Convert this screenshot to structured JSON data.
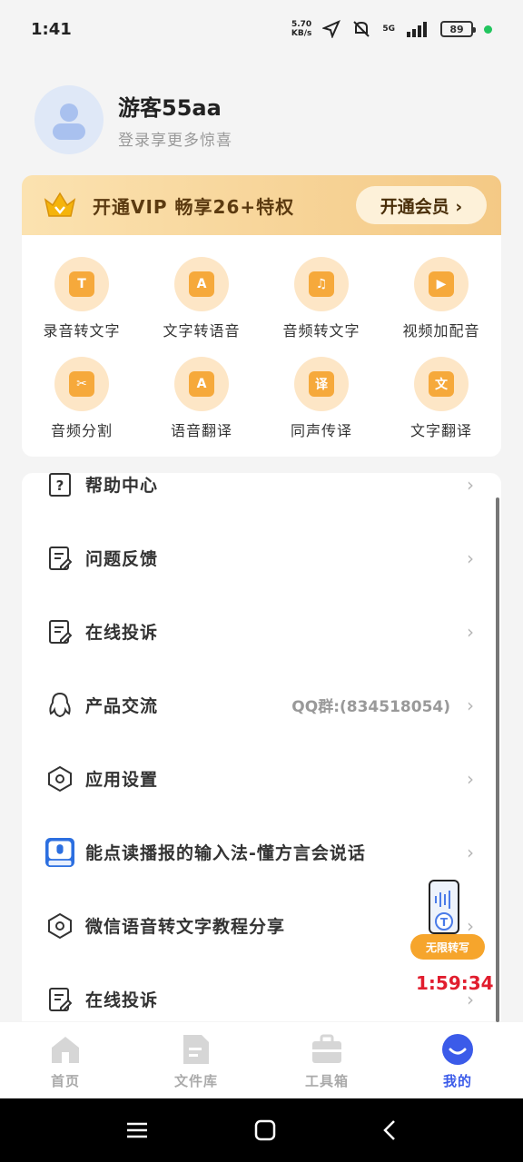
{
  "status": {
    "time": "1:41",
    "net_speed": "5.70",
    "net_unit": "KB/s",
    "signal": "5G",
    "battery": "89"
  },
  "profile": {
    "name": "游客55aa",
    "subtitle": "登录享更多惊喜"
  },
  "vip": {
    "text": "开通VIP 畅享26+特权",
    "button": "开通会员 ›"
  },
  "tools": [
    {
      "label": "录音转文字",
      "icon": "mic-text-icon"
    },
    {
      "label": "文字转语音",
      "icon": "text-speech-icon"
    },
    {
      "label": "音频转文字",
      "icon": "audio-text-icon"
    },
    {
      "label": "视频加配音",
      "icon": "video-dub-icon"
    },
    {
      "label": "音频分割",
      "icon": "scissors-icon"
    },
    {
      "label": "语音翻译",
      "icon": "voice-translate-icon"
    },
    {
      "label": "同声传译",
      "icon": "interpret-icon"
    },
    {
      "label": "文字翻译",
      "icon": "text-translate-icon"
    }
  ],
  "tool_glyphs": [
    "T",
    "A",
    "♫",
    "▶",
    "✂",
    "A",
    "译",
    "文"
  ],
  "menu": [
    {
      "label": "帮助中心",
      "extra": ""
    },
    {
      "label": "问题反馈",
      "extra": ""
    },
    {
      "label": "在线投诉",
      "extra": ""
    },
    {
      "label": "产品交流",
      "extra": "QQ群:(834518054)"
    },
    {
      "label": "应用设置",
      "extra": ""
    },
    {
      "label": "能点读播报的输入法-懂方言会说话",
      "extra": ""
    },
    {
      "label": "微信语音转文字教程分享",
      "extra": ""
    },
    {
      "label": "在线投诉",
      "extra": ""
    }
  ],
  "promo": {
    "badge": "无限转写",
    "timer": "1:59:34"
  },
  "tabs": [
    {
      "label": "首页"
    },
    {
      "label": "文件库"
    },
    {
      "label": "工具箱"
    },
    {
      "label": "我的"
    }
  ],
  "colors": {
    "accent": "#3b5be9",
    "orange": "#f6a93b",
    "vip_text": "#5b3a10",
    "timer_red": "#e11d2e"
  }
}
